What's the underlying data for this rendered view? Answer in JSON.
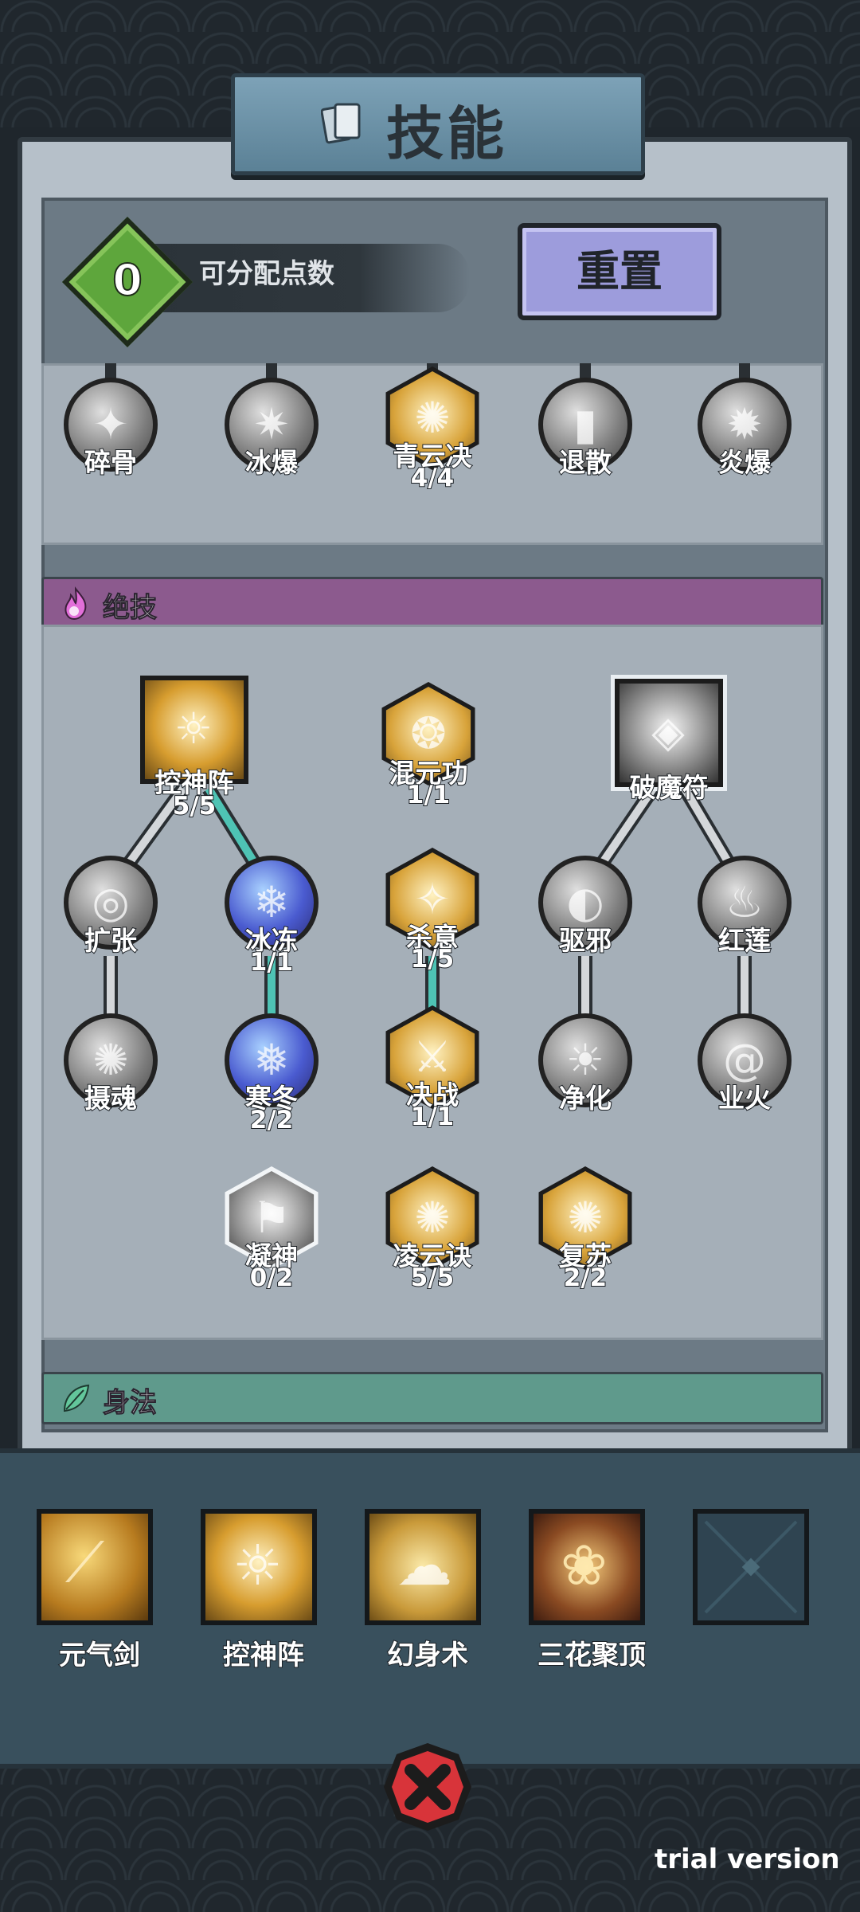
{
  "title": "技能",
  "header": {
    "points_value": "0",
    "points_label": "可分配点数",
    "reset_label": "重置"
  },
  "top_skills": [
    {
      "name": "碎骨",
      "level": ""
    },
    {
      "name": "冰爆",
      "level": ""
    },
    {
      "name": "青云决",
      "level": "4/4"
    },
    {
      "name": "退散",
      "level": ""
    },
    {
      "name": "炎爆",
      "level": ""
    }
  ],
  "sections": {
    "ultimate": "绝技",
    "movement": "身法"
  },
  "ult_skills": [
    {
      "name": "控神阵",
      "level": "5/5"
    },
    {
      "name": "混元功",
      "level": "1/1"
    },
    {
      "name": "破魔符",
      "level": ""
    },
    {
      "name": "扩张",
      "level": ""
    },
    {
      "name": "冰冻",
      "level": "1/1"
    },
    {
      "name": "杀意",
      "level": "1/5"
    },
    {
      "name": "驱邪",
      "level": ""
    },
    {
      "name": "红莲",
      "level": ""
    },
    {
      "name": "摄魂",
      "level": ""
    },
    {
      "name": "寒冬",
      "level": "2/2"
    },
    {
      "name": "决战",
      "level": "1/1"
    },
    {
      "name": "净化",
      "level": ""
    },
    {
      "name": "业火",
      "level": ""
    },
    {
      "name": "凝神",
      "level": "0/2"
    },
    {
      "name": "凌云诀",
      "level": "5/5"
    },
    {
      "name": "复苏",
      "level": "2/2"
    }
  ],
  "equipped": [
    {
      "name": "元气剑"
    },
    {
      "name": "控神阵"
    },
    {
      "name": "幻身术"
    },
    {
      "name": "三花聚顶"
    },
    {
      "name": ""
    }
  ],
  "watermark": "trial version",
  "colors": {
    "accent_teal": "#4ec3b4",
    "points_green": "#5ea63c",
    "reset_purple": "#9d9cdc",
    "ult_bar": "#8c5a8e",
    "move_bar": "#5f9a8c",
    "close_red": "#d8343a"
  }
}
